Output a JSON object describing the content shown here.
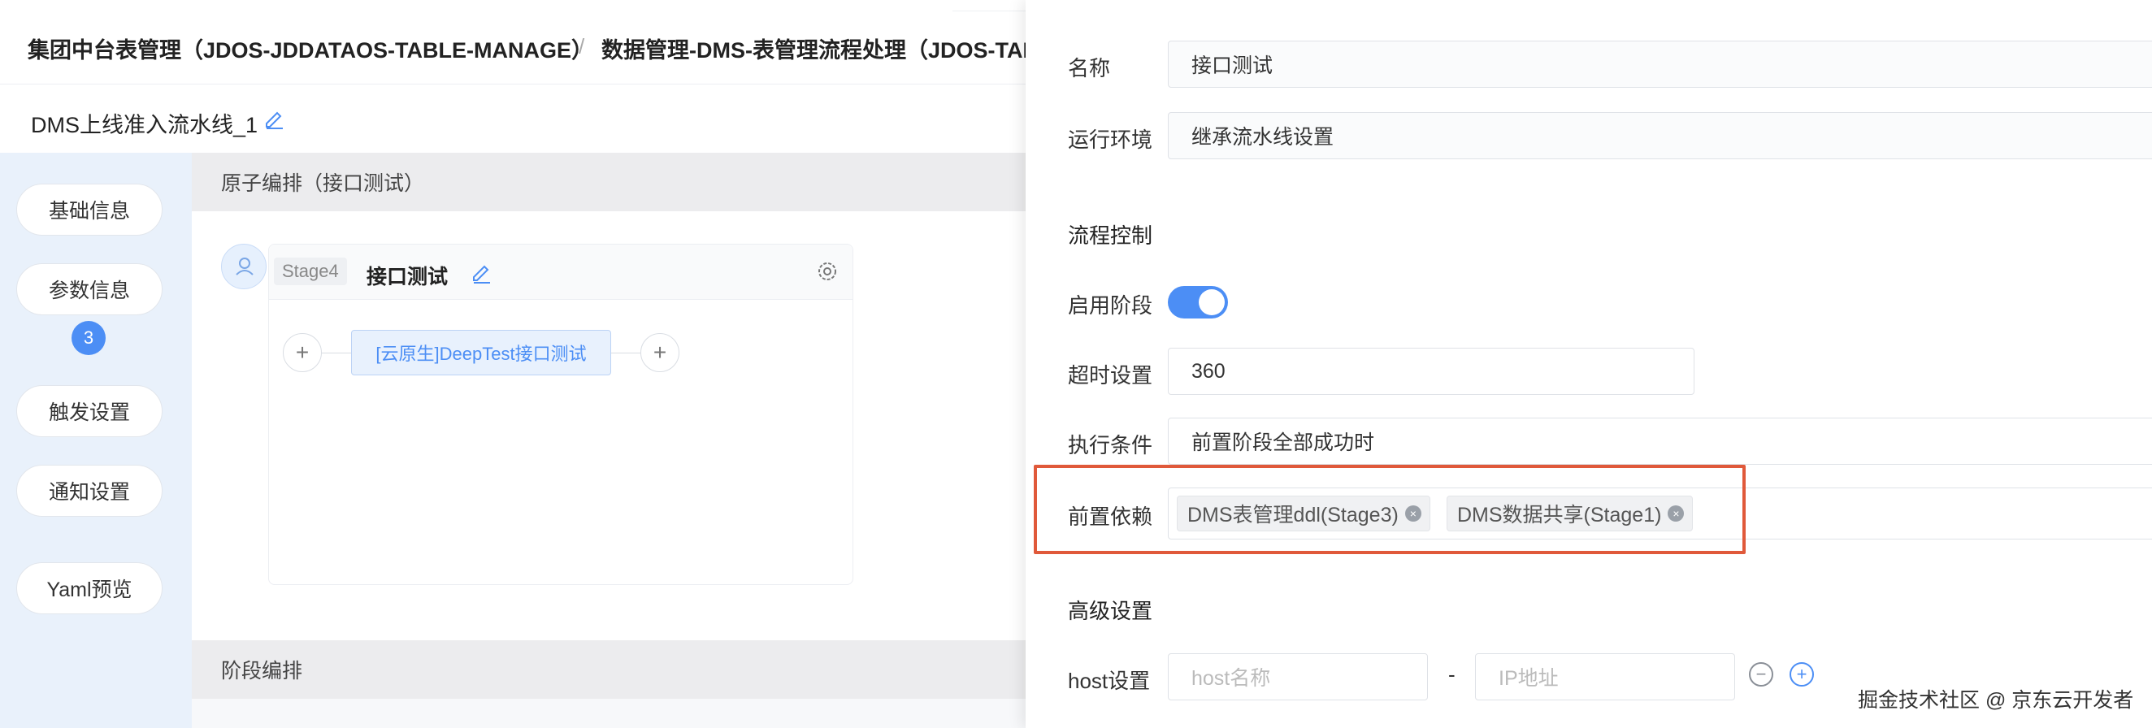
{
  "breadcrumb": {
    "item1": "集团中台表管理（JDOS-JDDATAOS-TABLE-MANAGE）",
    "separator": "/",
    "item2": "数据管理-DMS-表管理流程处理（JDOS-TABL"
  },
  "pipeline": {
    "name": "DMS上线准入流水线_1"
  },
  "sidebar": {
    "items": [
      {
        "label": "基础信息"
      },
      {
        "label": "参数信息",
        "badge": "3"
      },
      {
        "label": "触发设置"
      },
      {
        "label": "通知设置"
      },
      {
        "label": "Yaml预览"
      }
    ]
  },
  "editor": {
    "atom_section_title": "原子编排（接口测试）",
    "stage_section_title": "阶段编排",
    "stage": {
      "tag": "Stage4",
      "title": "接口测试",
      "task_label": "[云原生]DeepTest接口测试",
      "add_symbol": "+"
    }
  },
  "drawer": {
    "name": {
      "label": "名称",
      "value": "接口测试"
    },
    "env": {
      "label": "运行环境",
      "value": "继承流水线设置"
    },
    "flow_control": {
      "title": "流程控制"
    },
    "enable_stage": {
      "label": "启用阶段",
      "enabled": true
    },
    "timeout": {
      "label": "超时设置",
      "value": "360"
    },
    "condition": {
      "label": "执行条件",
      "value": "前置阶段全部成功时"
    },
    "dependencies": {
      "label": "前置依赖",
      "tags": [
        "DMS表管理ddl(Stage3)",
        "DMS数据共享(Stage1)"
      ]
    },
    "advanced": {
      "title": "高级设置"
    },
    "host": {
      "label": "host设置",
      "name_placeholder": "host名称",
      "dash": "-",
      "ip_placeholder": "IP地址",
      "minus_symbol": "−",
      "plus_symbol": "+"
    }
  },
  "watermark": "掘金技术社区 @ 京东云开发者",
  "colors": {
    "accent": "#4c8ef5",
    "highlight": "#e0593a",
    "sidebar_bg": "#e9f1fb"
  }
}
